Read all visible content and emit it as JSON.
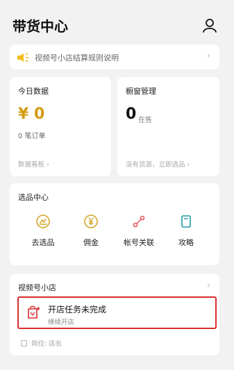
{
  "header": {
    "title": "带货中心",
    "profile_icon": "person-icon"
  },
  "notice": {
    "icon": "speaker-icon",
    "text": "视频号小店结算规则说明",
    "chevron": "›"
  },
  "today_data": {
    "title": "今日数据",
    "amount": "¥ 0",
    "orders": "0 笔订单",
    "link": "数据看板",
    "chevron": "›"
  },
  "window": {
    "title": "橱窗管理",
    "count": "0",
    "count_label": "在售",
    "link": "没有货源，立即选品",
    "chevron": "›"
  },
  "selection": {
    "title": "选品中心",
    "items": [
      {
        "label": "去选品",
        "icon": "shopping-bag-icon"
      },
      {
        "label": "佣金",
        "icon": "yen-coin-icon"
      },
      {
        "label": "帐号关联",
        "icon": "account-link-icon"
      },
      {
        "label": "攻略",
        "icon": "book-icon"
      }
    ]
  },
  "shop": {
    "title": "视频号小店",
    "chevron": "›",
    "task_title": "开店任务未完成",
    "task_subtitle": "继续开店",
    "position": "岗位: 店长"
  },
  "colors": {
    "accent": "#d49b12",
    "icon_gold": "#d2a52b",
    "icon_pink": "#e8545d",
    "icon_teal": "#1f9aa8",
    "highlight_red": "#d82c2c"
  }
}
